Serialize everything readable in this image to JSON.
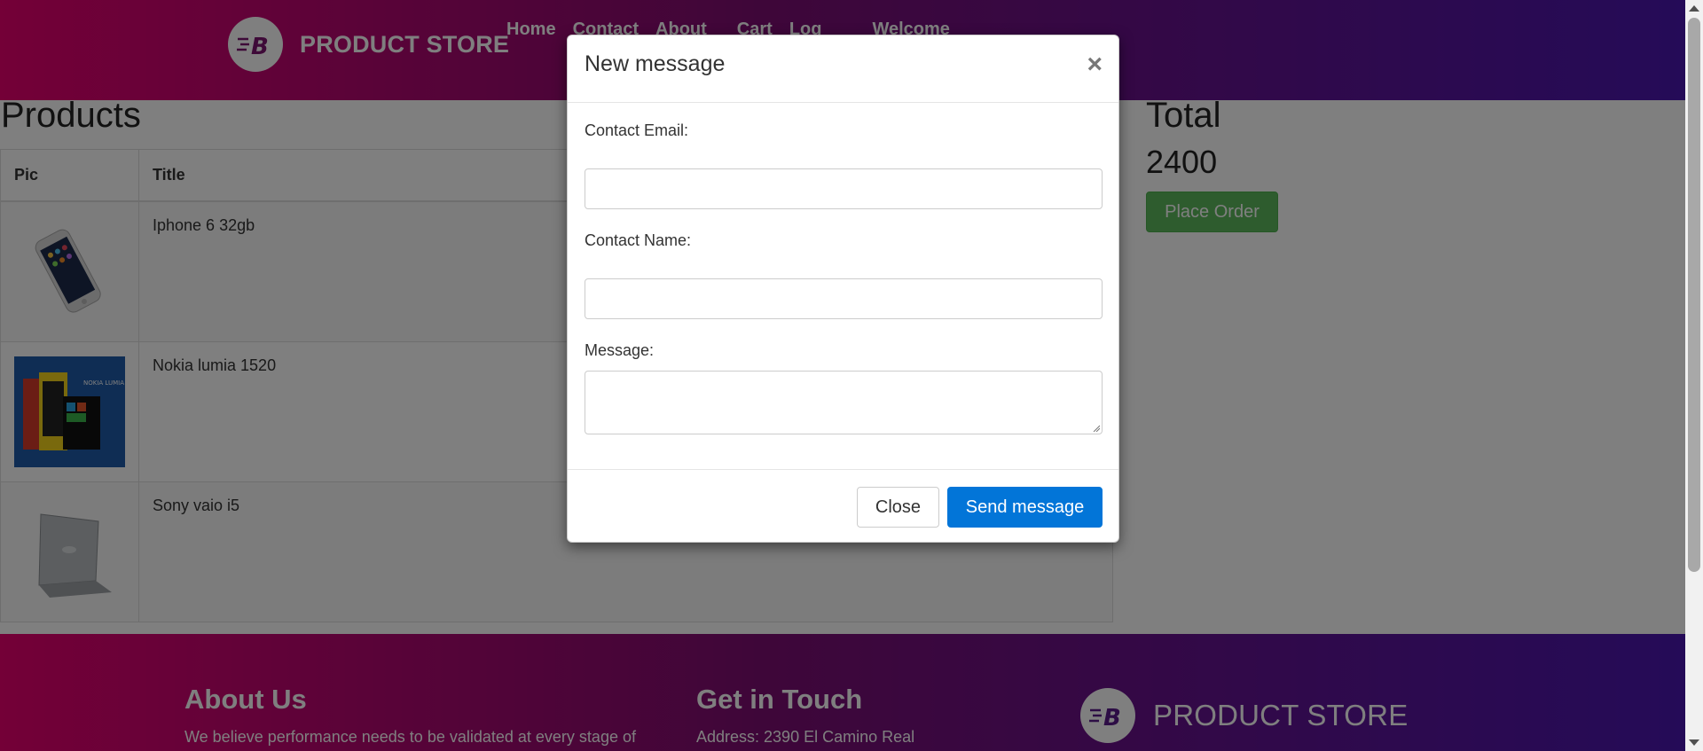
{
  "navbar": {
    "brand": "PRODUCT STORE",
    "links": [
      "Home",
      "Contact",
      "About",
      "Cart",
      "Log",
      "Welcome"
    ]
  },
  "products": {
    "title": "Products",
    "headers": [
      "Pic",
      "Title"
    ],
    "rows": [
      {
        "title": "Iphone 6 32gb"
      },
      {
        "title": "Nokia lumia 1520"
      },
      {
        "title": "Sony vaio i5"
      }
    ]
  },
  "total": {
    "title": "Total",
    "value": "2400",
    "place_order_label": "Place Order"
  },
  "footer": {
    "about_title": "About Us",
    "about_text": "We believe performance needs to be validated at every stage of",
    "contact_title": "Get in Touch",
    "contact_text": "Address: 2390 El Camino Real",
    "brand": "PRODUCT STORE"
  },
  "modal": {
    "title": "New message",
    "close_icon": "×",
    "email_label": "Contact Email:",
    "email_value": "",
    "name_label": "Contact Name:",
    "name_value": "",
    "message_label": "Message:",
    "message_value": "",
    "close_label": "Close",
    "send_label": "Send message"
  },
  "colors": {
    "nav_gradient_start": "#e8006f",
    "nav_gradient_end": "#4a17b0",
    "place_order": "#5cb85c",
    "send_button": "#0275d8"
  },
  "icons": {
    "brand_logo": "bolt-b-logo-icon",
    "modal_close": "close-icon"
  }
}
